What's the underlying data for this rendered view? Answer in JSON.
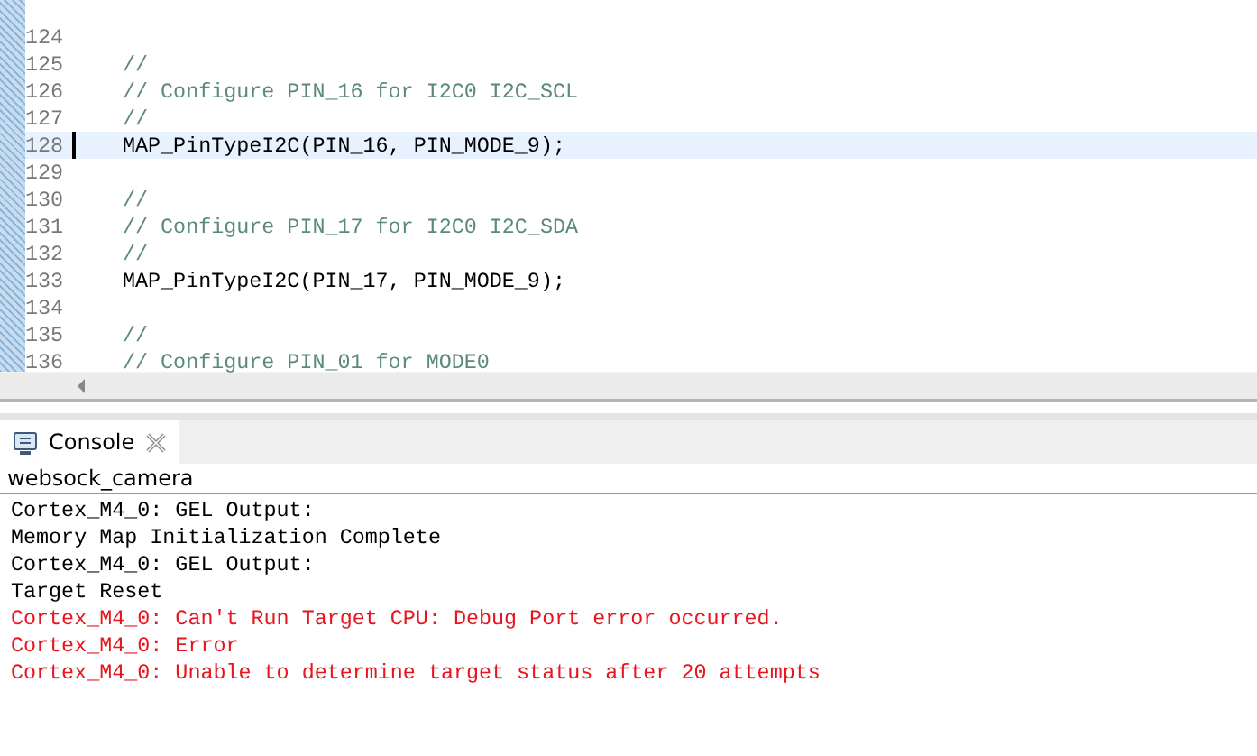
{
  "editor": {
    "lines": [
      {
        "number": "124",
        "kind": "blank",
        "current": false
      },
      {
        "number": "125",
        "text": "//",
        "kind": "comment",
        "current": false
      },
      {
        "number": "126",
        "text": "// Configure PIN_16 for I2C0 I2C_SCL",
        "kind": "comment",
        "current": false
      },
      {
        "number": "127",
        "text": "//",
        "kind": "comment",
        "current": false
      },
      {
        "number": "128",
        "text": "MAP_PinTypeI2C(PIN_16, PIN_MODE_9);",
        "kind": "code",
        "current": true
      },
      {
        "number": "129",
        "kind": "blank",
        "current": false
      },
      {
        "number": "130",
        "text": "//",
        "kind": "comment",
        "current": false
      },
      {
        "number": "131",
        "text": "// Configure PIN_17 for I2C0 I2C_SDA",
        "kind": "comment",
        "current": false
      },
      {
        "number": "132",
        "text": "//",
        "kind": "comment",
        "current": false
      },
      {
        "number": "133",
        "text": "MAP_PinTypeI2C(PIN_17, PIN_MODE_9);",
        "kind": "code",
        "current": false
      },
      {
        "number": "134",
        "kind": "blank",
        "current": false
      },
      {
        "number": "135",
        "text": "//",
        "kind": "comment",
        "current": false
      },
      {
        "number": "136",
        "text": "// Configure PIN_01 for MODE0",
        "kind": "comment",
        "current": false
      }
    ]
  },
  "console": {
    "tab": {
      "label": "Console",
      "selected": true
    },
    "title": "websock_camera",
    "lines": [
      {
        "text": "Cortex_M4_0: GEL Output:",
        "kind": "info"
      },
      {
        "text": "Memory Map Initialization Complete",
        "kind": "info"
      },
      {
        "text": "Cortex_M4_0: GEL Output:",
        "kind": "info"
      },
      {
        "text": "Target Reset",
        "kind": "info"
      },
      {
        "text": "Cortex_M4_0: Can't Run Target CPU: Debug Port error occurred.",
        "kind": "error"
      },
      {
        "text": "Cortex_M4_0: Error",
        "kind": "error"
      },
      {
        "text": "Cortex_M4_0: Unable to determine target status after 20 attempts",
        "kind": "error"
      }
    ]
  }
}
